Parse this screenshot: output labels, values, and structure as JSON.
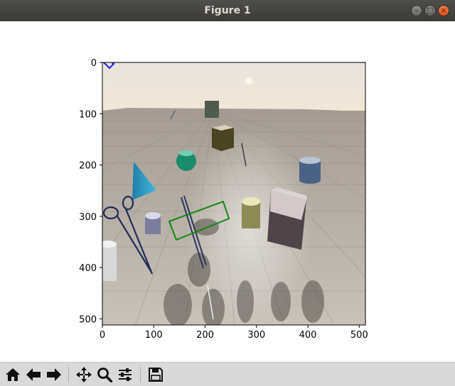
{
  "window": {
    "title": "Figure 1",
    "controls": [
      "minimize",
      "maximize",
      "close"
    ]
  },
  "plot": {
    "image_description_semantic": "rendered-3d-scene",
    "xlim": [
      0,
      512
    ],
    "ylim": [
      512,
      0
    ],
    "x_ticks": [
      "0",
      "100",
      "200",
      "300",
      "400",
      "500"
    ],
    "y_ticks": [
      "0",
      "100",
      "200",
      "300",
      "400",
      "500"
    ],
    "overlay_colors": {
      "green_box": "#118811",
      "blue_marker": "#1a1ae0"
    }
  },
  "toolbar": {
    "buttons": [
      {
        "name": "home-icon"
      },
      {
        "name": "back-arrow-icon"
      },
      {
        "name": "forward-arrow-icon"
      },
      {
        "name": "pan-icon"
      },
      {
        "name": "zoom-icon"
      },
      {
        "name": "configure-subplots-icon"
      },
      {
        "name": "save-icon"
      }
    ]
  }
}
